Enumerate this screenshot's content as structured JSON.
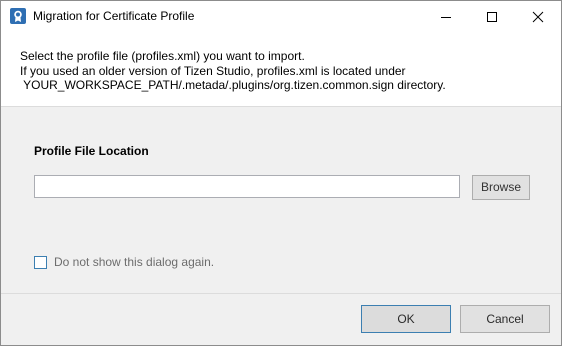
{
  "window": {
    "title": "Migration for Certificate Profile",
    "controls": {
      "minimize_icon": "minimize-icon",
      "maximize_icon": "maximize-icon",
      "close_icon": "close-icon"
    }
  },
  "description": {
    "line1": "Select the profile file (profiles.xml) you want to import.",
    "line2": "If you used an older version of Tizen Studio, profiles.xml is located under",
    "line3": " YOUR_WORKSPACE_PATH/.metada/.plugins/org.tizen.common.sign directory."
  },
  "form": {
    "section_label": "Profile File Location",
    "location_value": "",
    "location_placeholder": "",
    "browse_label": "Browse",
    "checkbox_label": "Do not show this dialog again.",
    "checkbox_checked": false
  },
  "footer": {
    "ok_label": "OK",
    "cancel_label": "Cancel"
  },
  "colors": {
    "accent": "#3c7fb1",
    "panel": "#f0f0f0",
    "button": "#e1e1e1"
  }
}
